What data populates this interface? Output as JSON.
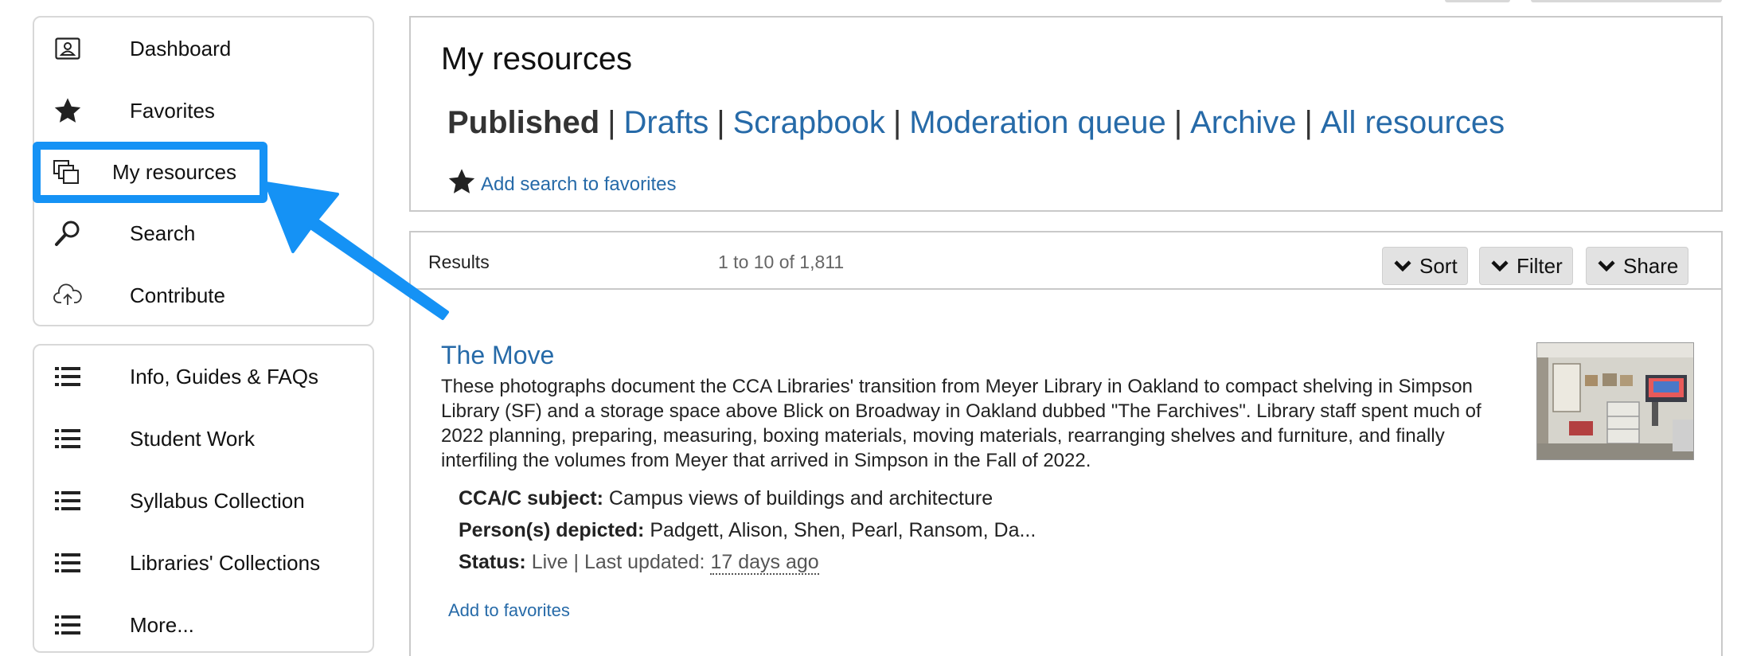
{
  "sidebar": {
    "items": [
      {
        "label": "Dashboard",
        "icon": "dashboard-icon"
      },
      {
        "label": "Favorites",
        "icon": "star-icon"
      },
      {
        "label": "My resources",
        "icon": "my-resources-icon",
        "active": true
      },
      {
        "label": "Search",
        "icon": "search-icon"
      },
      {
        "label": "Contribute",
        "icon": "cloud-upload-icon"
      }
    ],
    "collections": [
      {
        "label": "Info, Guides & FAQs",
        "icon": "list-icon"
      },
      {
        "label": "Student Work",
        "icon": "list-icon"
      },
      {
        "label": "Syllabus Collection",
        "icon": "list-icon"
      },
      {
        "label": "Libraries' Collections",
        "icon": "list-icon"
      },
      {
        "label": "More...",
        "icon": "list-icon"
      }
    ]
  },
  "header": {
    "title": "My resources",
    "filters": {
      "current": "Published",
      "links": [
        "Drafts",
        "Scrapbook",
        "Moderation queue",
        "Archive",
        "All resources"
      ]
    },
    "add_search_favorites": "Add search to favorites"
  },
  "results": {
    "label": "Results",
    "count": "1 to 10 of 1,811",
    "buttons": {
      "sort": "Sort",
      "filter": "Filter",
      "share": "Share"
    }
  },
  "resource": {
    "title": "The Move",
    "description": "These photographs document the CCA Libraries' transition from Meyer Library in Oakland to compact shelving in Simpson Library (SF) and a storage space above Blick on Broadway in Oakland dubbed \"The Farchives\". Library staff spent much of 2022 planning, preparing, measuring, boxing materials, moving materials, rearranging shelves and furniture, and finally interfiling the volumes from Meyer that arrived in Simpson in the Fall of 2022.",
    "subject_label": "CCA/C subject:",
    "subject_value": "Campus views of buildings and architecture",
    "persons_label": "Person(s) depicted:",
    "persons_value": "Padgett, Alison, Shen, Pearl, Ransom, Da...",
    "status_label": "Status:",
    "status_value": "Live",
    "updated_label": "| Last updated:",
    "updated_value": "17 days ago",
    "add_favorites": "Add to favorites"
  },
  "colors": {
    "link": "#266aa8",
    "highlight": "#1592f5",
    "border": "#c9c9c9"
  }
}
